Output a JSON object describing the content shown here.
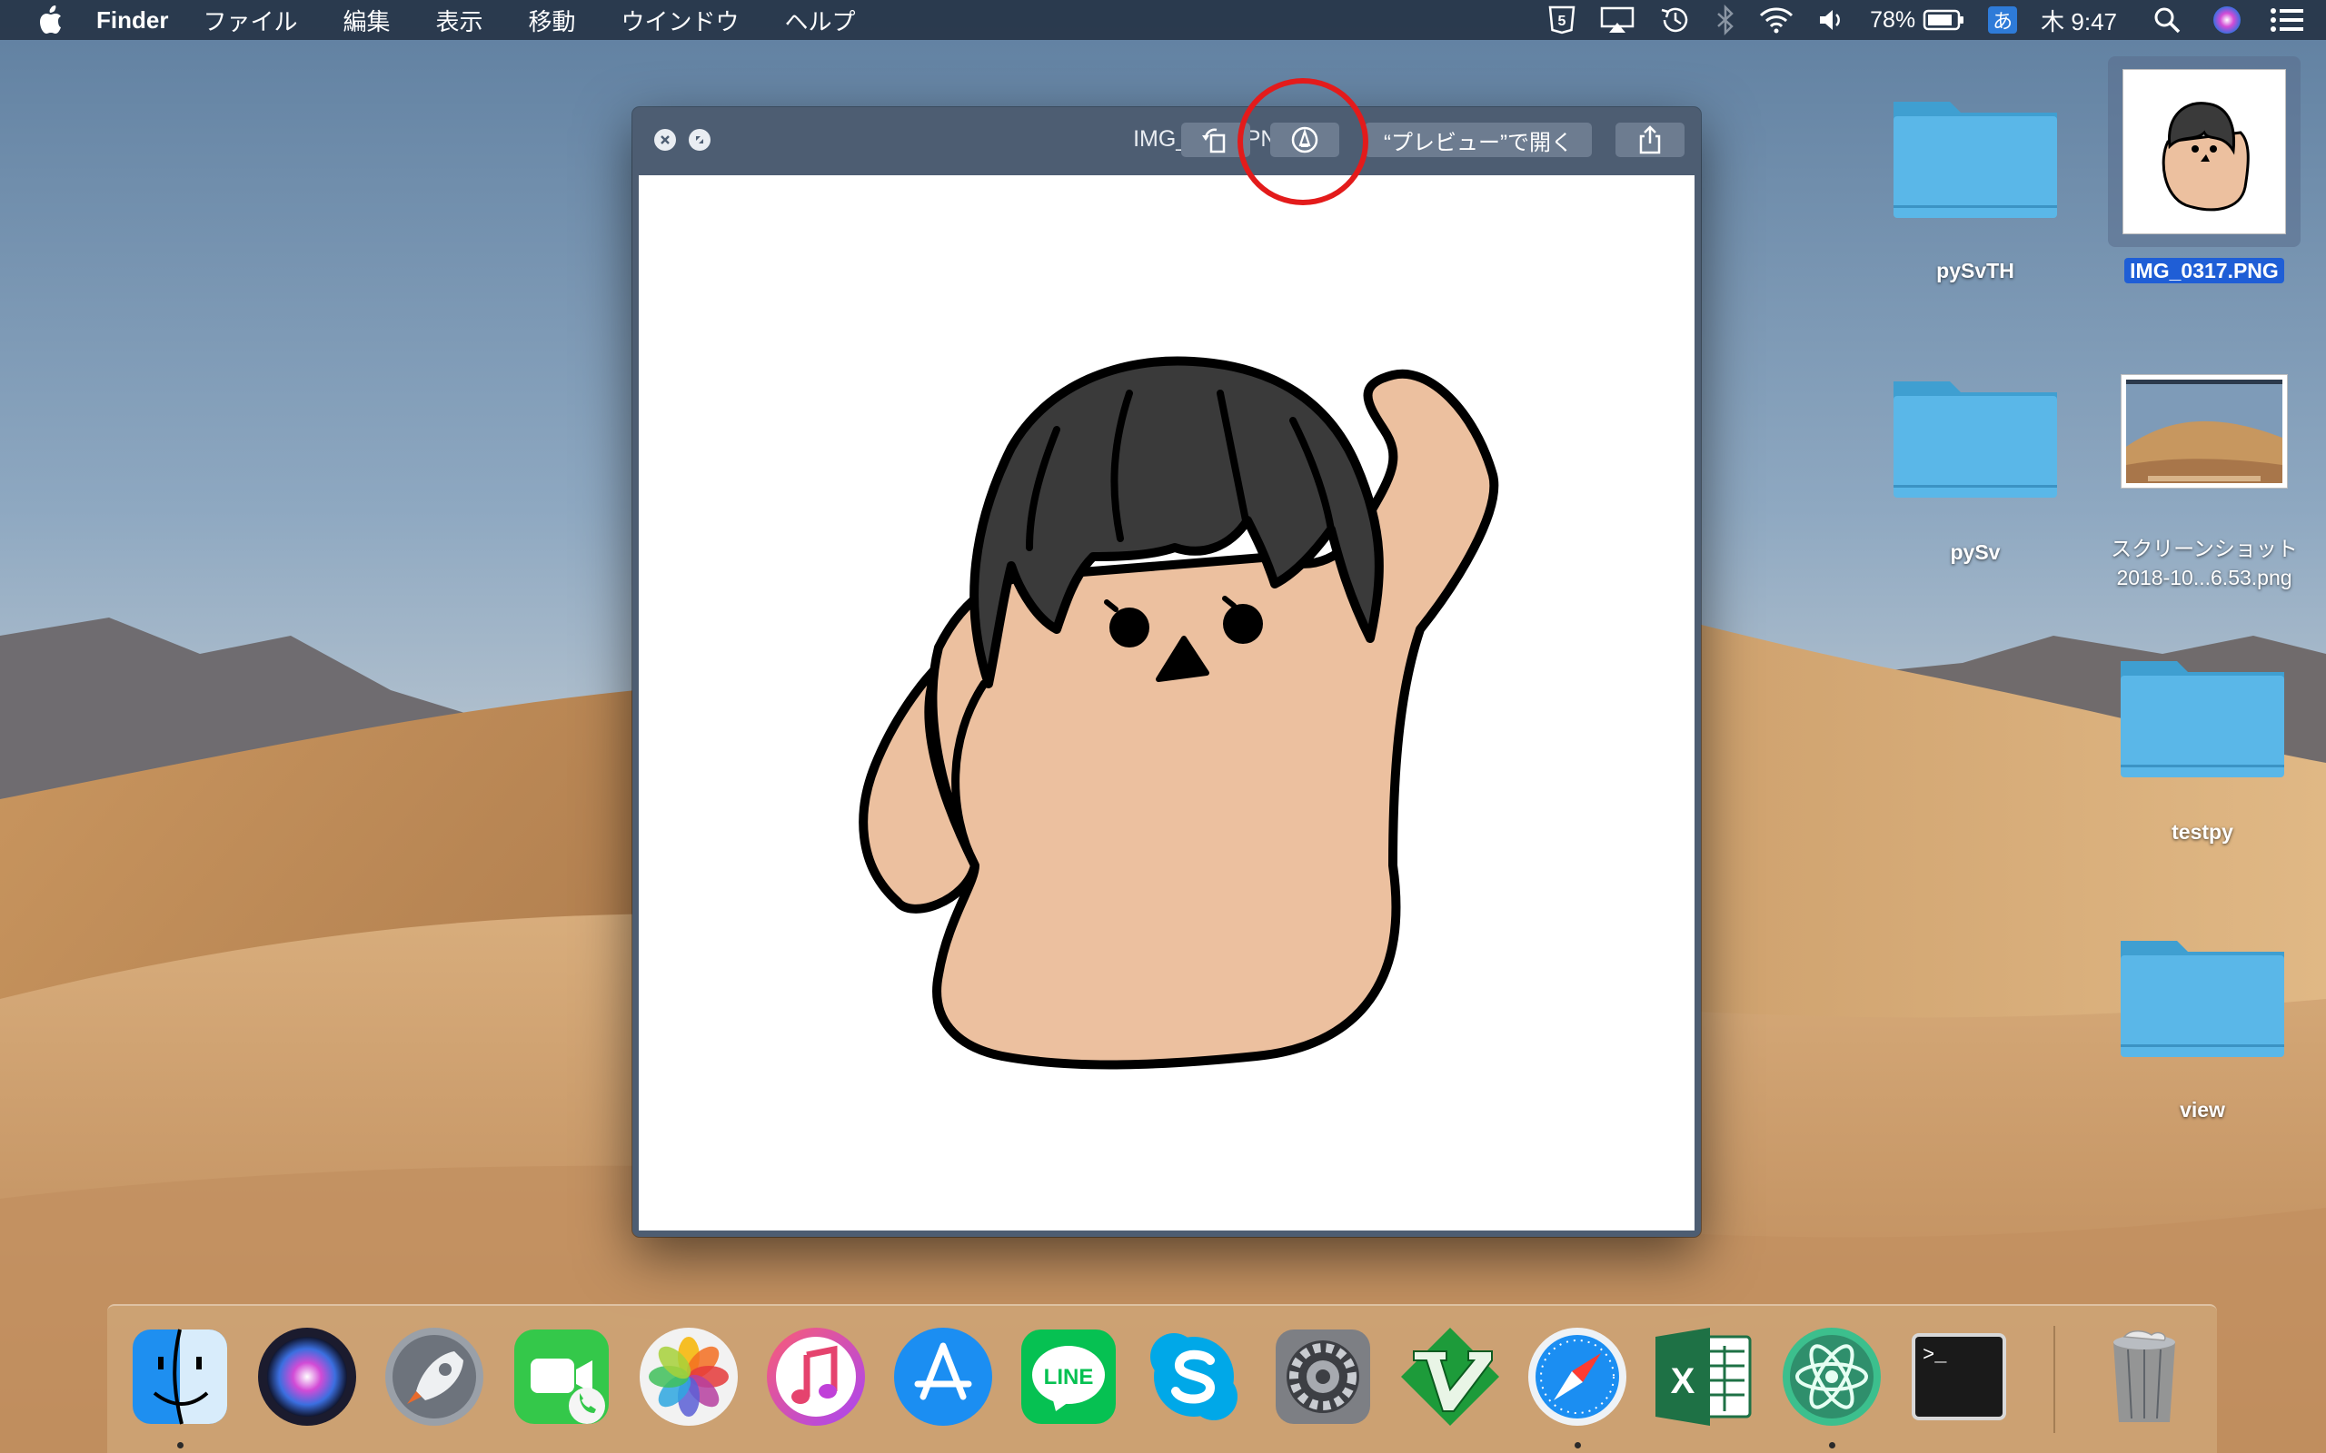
{
  "menubar": {
    "app_name": "Finder",
    "menus": [
      "ファイル",
      "編集",
      "表示",
      "移動",
      "ウインドウ",
      "ヘルプ"
    ],
    "battery_percent": "78%",
    "ime_label": "あ",
    "clock": "木 9:47"
  },
  "desktop": {
    "icons": [
      {
        "name": "pySvTH",
        "kind": "folder"
      },
      {
        "name": "IMG_0317.PNG",
        "kind": "image",
        "selected": true
      },
      {
        "name": "pySv",
        "kind": "folder"
      },
      {
        "name_line1": "スクリーンショット",
        "name_line2": "2018-10...6.53.png",
        "kind": "image"
      },
      {
        "name": "testpy",
        "kind": "folder"
      },
      {
        "name": "view",
        "kind": "folder"
      }
    ]
  },
  "quicklook": {
    "title": "IMG_0317.PNG",
    "open_with_label": "“プレビュー”で開く"
  },
  "dock": {
    "apps": [
      "finder",
      "siri",
      "launchpad",
      "facetime",
      "photos",
      "itunes",
      "app-store",
      "line",
      "skype",
      "system-preferences",
      "vim",
      "safari",
      "excel",
      "atom",
      "terminal",
      "trash"
    ],
    "line_label": "LINE",
    "excel_label": "X",
    "terminal_prompt": ">_"
  },
  "colors": {
    "menubar_bg": "#263446",
    "window_bg": "#4d5d72",
    "selection": "#1f5ed6",
    "annotation": "#e31b1b",
    "skin": "#ecc09f",
    "hair": "#3a3a3a"
  }
}
